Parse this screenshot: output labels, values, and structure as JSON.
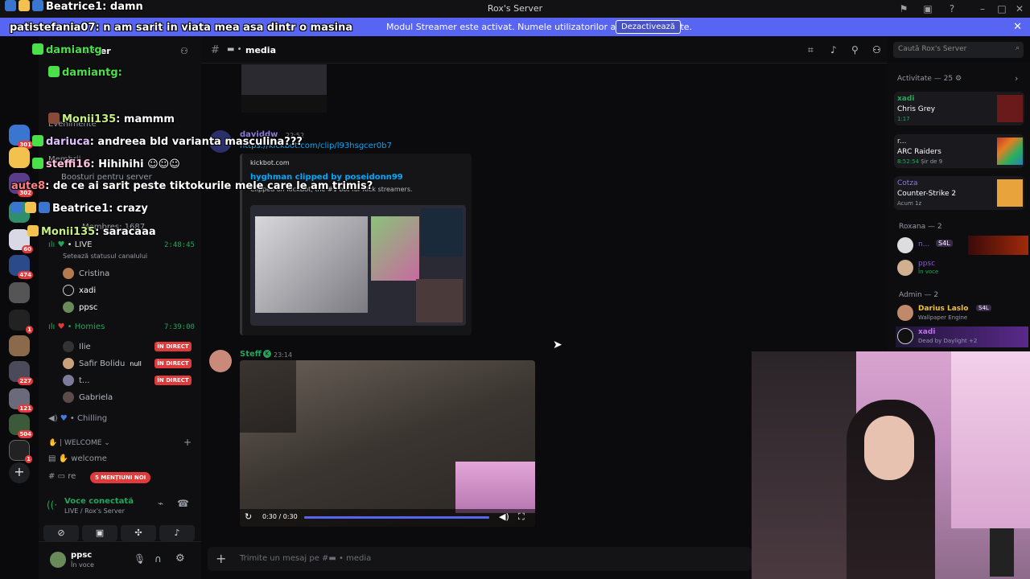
{
  "window": {
    "title": "Rox's Server"
  },
  "banner": {
    "text": "Modul Streamer este activat. Numele utilizatorilor au fost trunchiate.",
    "button": "Dezactivează"
  },
  "rail": {
    "badges": [
      "301",
      "302",
      "60",
      "474",
      "1",
      "227",
      "121",
      "504",
      "1"
    ]
  },
  "sidebar": {
    "server_name": "Rox's Server",
    "events": "Evenimente",
    "members_label": "Membrii",
    "boosts": "Boosturi pentru server",
    "members_count": "Membres: 1687",
    "live_channel": "LIVE",
    "live_time": "2:48:45",
    "status_hint": "Setează statusul canalului",
    "live_users": [
      "Cristina",
      "xadi",
      "ppsc"
    ],
    "homies_channel": "Homies",
    "homies_time": "7:39:00",
    "homies_users": [
      {
        "name": "Ilie",
        "badge": "ÎN DIRECT"
      },
      {
        "name": "Safir Bolidu",
        "extra": "null",
        "badge": "ÎN DIRECT"
      },
      {
        "name": "t...",
        "badge": "ÎN DIRECT"
      },
      {
        "name": "Gabriela",
        "badge": ""
      }
    ],
    "chilling": "Chilling",
    "welcome_cat": "| WELCOME",
    "welcome": "welcome",
    "re": "re",
    "mentions": "5 MENȚIUNI NOI",
    "voice_status": "Voce conectată",
    "voice_where": "LIVE / Rox's Server",
    "user_name": "ppsc",
    "user_status": "În voce"
  },
  "header": {
    "channel": "media"
  },
  "search": {
    "placeholder": "Caută Rox's Server"
  },
  "messages": [
    {
      "author": "daviddw",
      "time": "22:52",
      "link": "https://kickbot.com/clip/l93hsgcer0b7",
      "embed_site": "kickbot.com",
      "embed_title": "hyghman clipped by poseidonn99",
      "embed_desc": "Clipped on KickBot, the #1 bot for Kick streamers."
    },
    {
      "author": "Steff",
      "time": "23:14",
      "video_time": "0:30 / 0:30",
      "video_progress": 1.0
    }
  ],
  "composer": {
    "placeholder": "Trimite un mesaj pe #",
    "channel": "media"
  },
  "members": {
    "activity_title": "Activitate — 25",
    "activities": [
      {
        "user": "xadi",
        "title": "Chris Grey",
        "meta": "1:17",
        "color": "#1db954"
      },
      {
        "user": "r...",
        "title": "ARC Raiders",
        "meta": "8:52:54",
        "extra": "Șir de 9",
        "color": "#c0392b"
      },
      {
        "user": "Cotza",
        "title": "Counter-Strike 2",
        "meta": "Acum 1z",
        "color": "#e8a33d"
      }
    ],
    "group1": "Roxana — 2",
    "group1_members": [
      {
        "name": "n...",
        "tag": "S4L",
        "sub": ""
      },
      {
        "name": "ppsc",
        "tag": "",
        "sub": "În voce"
      }
    ],
    "group2": "Admin — 2",
    "group2_members": [
      {
        "name": "Darius Laslo",
        "tag": "S4L",
        "sub": "Wallpaper Engine"
      },
      {
        "name": "xadi",
        "tag": "",
        "sub": "Dead by Daylight +2"
      }
    ]
  },
  "overlay": [
    {
      "name": "Beatrice1",
      "msg": "damn"
    },
    {
      "name": "patistefania07",
      "msg": "n am sarit in viata mea asa dintr o masina"
    },
    {
      "name": "damiantg",
      "msg": ""
    },
    {
      "name": "damiantg",
      "msg": ""
    },
    {
      "name": "Monii135",
      "msg": "mammm"
    },
    {
      "name": "dariuca",
      "msg": "andreea bld varianta masculina???"
    },
    {
      "name": "steffi16",
      "msg": "Hihihihi"
    },
    {
      "name": "aute8",
      "msg": "de ce ai sarit peste tiktokurile mele care le am trimis?"
    },
    {
      "name": "Beatrice1",
      "msg": "crazy"
    },
    {
      "name": "Monii135",
      "msg": "saracaaa"
    }
  ]
}
